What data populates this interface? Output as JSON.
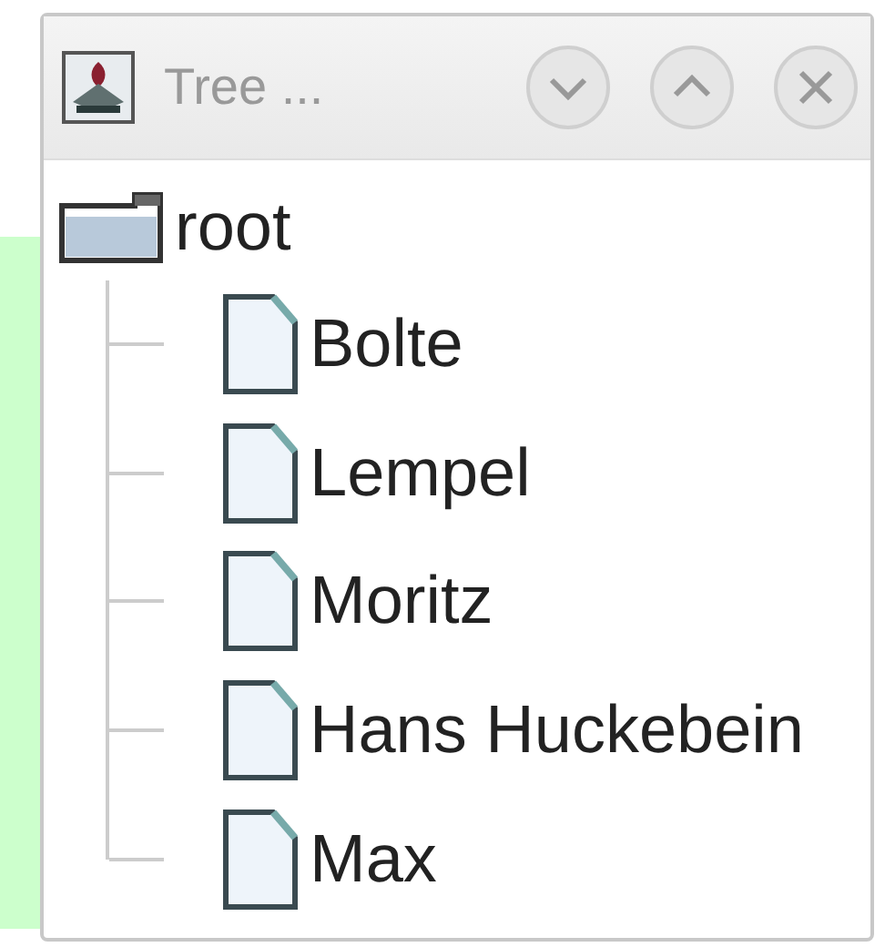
{
  "window": {
    "title": "Tree ...",
    "buttons": [
      {
        "kind": "minimize"
      },
      {
        "kind": "maximize"
      },
      {
        "kind": "close"
      }
    ]
  },
  "tree": {
    "label": "root",
    "children": [
      {
        "label": "Bolte"
      },
      {
        "label": "Lempel"
      },
      {
        "label": "Moritz"
      },
      {
        "label": "Hans Huckebein"
      },
      {
        "label": "Max"
      }
    ]
  }
}
